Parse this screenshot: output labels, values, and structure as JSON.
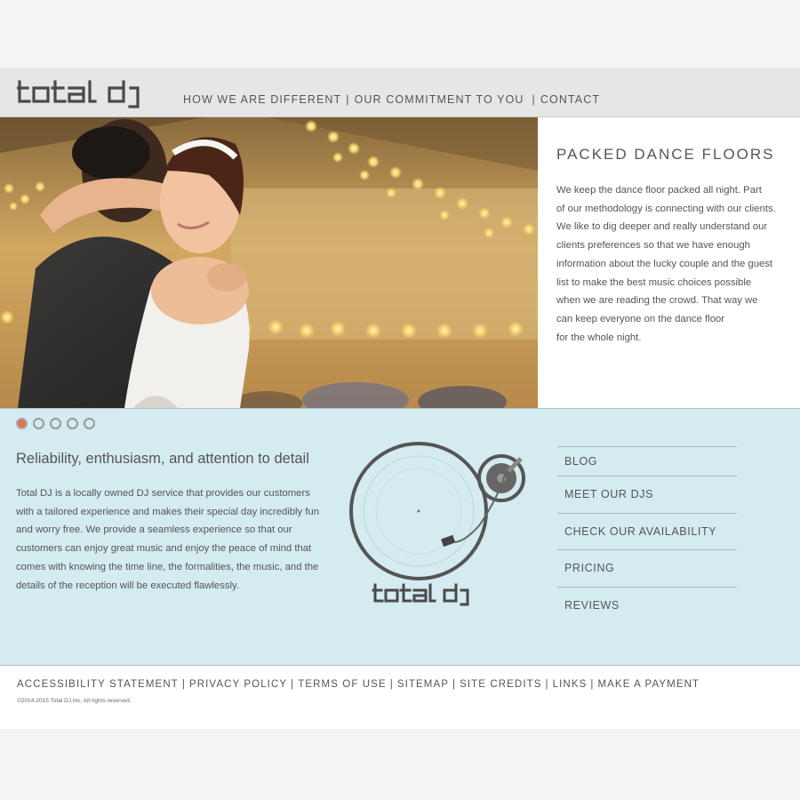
{
  "brand": {
    "logo_text": "total dj"
  },
  "nav": {
    "items": [
      {
        "label": "HOW WE ARE DIFFERENT"
      },
      {
        "label": "OUR COMMITMENT TO YOU"
      },
      {
        "label": "CONTACT"
      }
    ],
    "separator": "|"
  },
  "feature": {
    "title": "PACKED DANCE FLOORS",
    "lines": [
      "We keep the dance floor packed all night. Part",
      "of our methodology is connecting with our clients.",
      "We like to dig deeper and really understand our",
      "clients preferences so that we have enough",
      "information about the lucky couple and the guest",
      "list to make the best music choices possible",
      "when we are reading the crowd. That way we",
      "can keep everyone on the dance floor",
      "for the whole night."
    ]
  },
  "slider": {
    "count": 5,
    "active_index": 0,
    "active_color": "#e2734d"
  },
  "about": {
    "tagline": "Reliability, enthusiasm, and attention to detail",
    "lines": [
      "Total DJ is a locally owned DJ service that provides our customers",
      "with a tailored experience and makes their special day incredibly fun",
      "and worry free. We provide a seamless experience so that our",
      "customers can enjoy great music and enjoy the peace of mind that",
      "comes with knowing the time line, the formalities, the music, and the",
      "details of the reception will be executed flawlessly."
    ]
  },
  "quick_links": [
    {
      "label": "BLOG"
    },
    {
      "label": "MEET OUR DJS"
    },
    {
      "label": "CHECK OUR AVAILABILITY"
    },
    {
      "label": "PRICING"
    },
    {
      "label": "REVIEWS"
    }
  ],
  "footer": {
    "links": [
      {
        "label": "ACCESSIBILITY STATEMENT"
      },
      {
        "label": "PRIVACY POLICY"
      },
      {
        "label": "TERMS OF USE"
      },
      {
        "label": "SITEMAP"
      },
      {
        "label": "SITE CREDITS"
      },
      {
        "label": "LINKS"
      },
      {
        "label": "MAKE A PAYMENT"
      }
    ],
    "separator": "|",
    "copyright": "©2014-2015 Total DJ,Inc. All rights reserved."
  },
  "colors": {
    "header_bg": "#e6e6e6",
    "mid_bg": "#d4ebf0",
    "text": "#555555",
    "accent": "#e2734d"
  }
}
